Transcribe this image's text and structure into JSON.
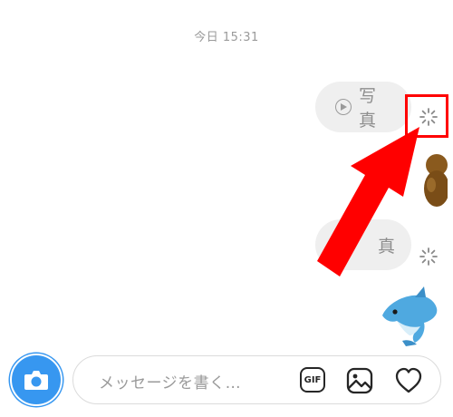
{
  "chat": {
    "timestamp": "今日 15:31",
    "messages": [
      {
        "type": "video",
        "label": "写真",
        "status": "sending"
      },
      {
        "type": "emoji",
        "status": "sent"
      },
      {
        "type": "video",
        "label": "真",
        "status": "sending"
      },
      {
        "type": "emoji",
        "emoji_name": "dolphin-emoji",
        "status": "sent"
      }
    ]
  },
  "composer": {
    "placeholder": "メッセージを書く…",
    "gif_label": "GIF",
    "icons": [
      "camera-icon",
      "gif-icon",
      "image-icon",
      "heart-icon"
    ]
  },
  "annotation": {
    "highlight_color": "#ff0000",
    "arrow_color": "#ff0000"
  },
  "colors": {
    "accent": "#3797f0",
    "bubble_bg": "#efefef",
    "muted_text": "#9a9a9a"
  }
}
